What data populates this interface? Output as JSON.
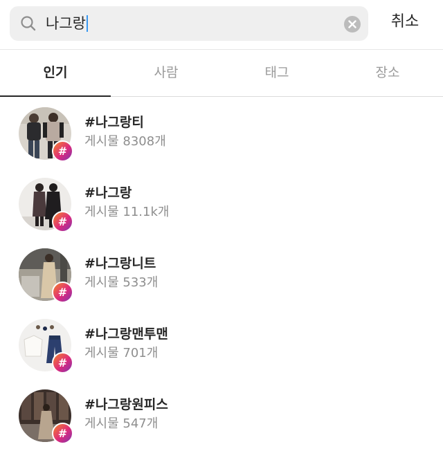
{
  "search": {
    "query": "나그랑",
    "icon": "search-icon",
    "clear_icon": "clear-icon"
  },
  "cancel_label": "취소",
  "tabs": [
    {
      "label": "인기",
      "active": true
    },
    {
      "label": "사람",
      "active": false
    },
    {
      "label": "태그",
      "active": false
    },
    {
      "label": "장소",
      "active": false
    }
  ],
  "results": [
    {
      "tag": "#나그랑티",
      "posts": "게시물 8308개"
    },
    {
      "tag": "#나그랑",
      "posts": "게시물 11.1k개"
    },
    {
      "tag": "#나그랑니트",
      "posts": "게시물 533개"
    },
    {
      "tag": "#나그랑맨투맨",
      "posts": "게시물 701개"
    },
    {
      "tag": "#나그랑원피스",
      "posts": "게시물 547개"
    }
  ],
  "badge_symbol": "#",
  "colors": {
    "accent_caret": "#3897f0",
    "badge_gradient": [
      "#f58529",
      "#dd2a7b",
      "#8134af"
    ],
    "text_primary": "#262626",
    "text_secondary": "#8e8e8e"
  }
}
